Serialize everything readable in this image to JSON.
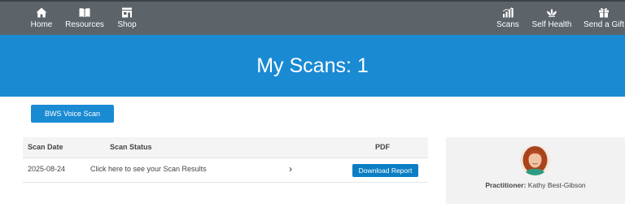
{
  "nav": {
    "left": [
      {
        "label": "Home",
        "icon": "home-icon"
      },
      {
        "label": "Resources",
        "icon": "book-icon"
      },
      {
        "label": "Shop",
        "icon": "store-icon"
      }
    ],
    "right": [
      {
        "label": "Scans",
        "icon": "bar-chart-icon"
      },
      {
        "label": "Self Health",
        "icon": "lotus-icon"
      },
      {
        "label": "Send a Gift",
        "icon": "gift-icon"
      }
    ]
  },
  "hero": {
    "title": "My Scans: 1"
  },
  "actions": {
    "voice_scan_label": "BWS Voice Scan"
  },
  "table": {
    "headers": {
      "date": "Scan Date",
      "status": "Scan Status",
      "pdf": "PDF"
    },
    "rows": [
      {
        "date": "2025-08-24",
        "status": "Click here to see your Scan Results",
        "chevron": "›",
        "download_label": "Download Report"
      }
    ]
  },
  "practitioner": {
    "label": "Practitioner:",
    "name": "Kathy Best-Gibson"
  },
  "colors": {
    "topbar": "#5c6369",
    "hero": "#1a8ad3",
    "button": "#1a8ad3",
    "download_button": "#0b7ec3",
    "card": "#f2f2f2"
  }
}
